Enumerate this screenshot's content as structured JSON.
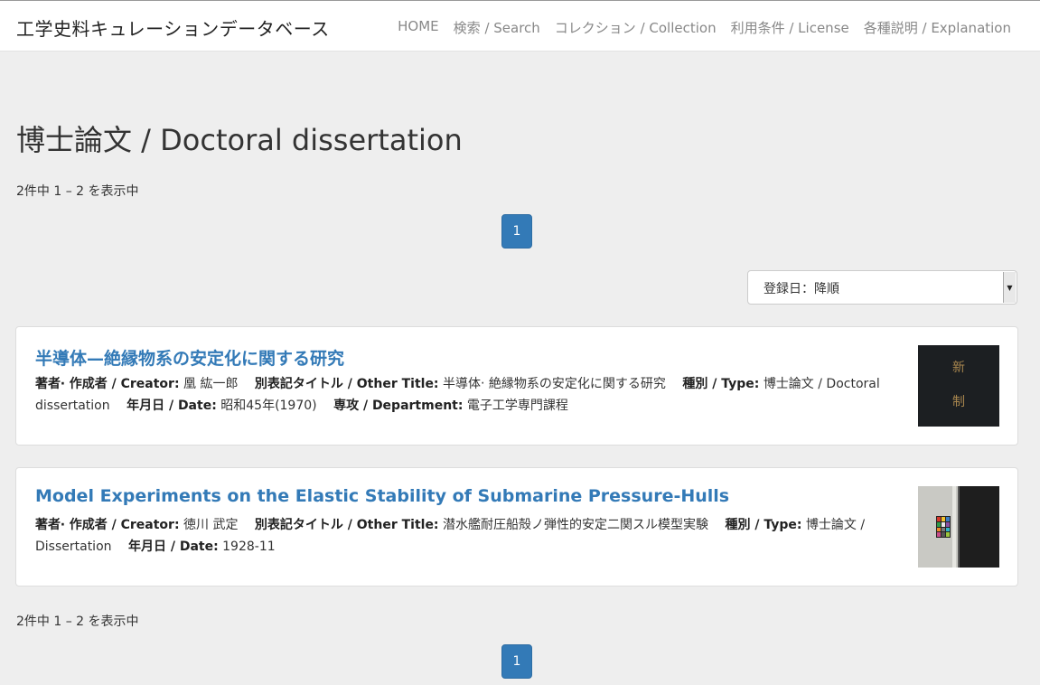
{
  "navbar": {
    "brand": "工学史料キュレーションデータベース",
    "items": [
      "HOME",
      "検索 / Search",
      "コレクション / Collection",
      "利用条件 / License",
      "各種説明 / Explanation"
    ]
  },
  "page": {
    "title": "博士論文 / Doctoral dissertation",
    "count_text": "2件中 1 – 2 を表示中",
    "current_page": "1",
    "sort_selected": "登録日：降順"
  },
  "labels": {
    "creator": "著者‧ 作成者 / Creator:",
    "other_title": "別表記タイトル / Other Title:",
    "type": "種別 / Type:",
    "date": "年月日 / Date:",
    "department": "専攻 / Department:"
  },
  "results": [
    {
      "title": "半導体—絶縁物系の安定化に関する研究",
      "creator": "凰 紘一郎",
      "other_title": "半導体‧ 絶縁物系の安定化に関する研究",
      "type": "博士論文 / Doctoral dissertation",
      "date": "昭和45年(1970)",
      "department": "電子工学専門課程",
      "thumb_chars": [
        "新",
        "制"
      ]
    },
    {
      "title": "Model Experiments on the Elastic Stability of Submarine Pressure-Hulls",
      "creator": "徳川 武定",
      "other_title": "潜水艦耐圧船殻ノ弾性的安定二関スル模型実験",
      "type": "博士論文 / Dissertation",
      "date": "1928-11"
    }
  ],
  "colors": {
    "link": "#337ab7",
    "background": "#eeeeee",
    "pager": "#337ab7"
  }
}
